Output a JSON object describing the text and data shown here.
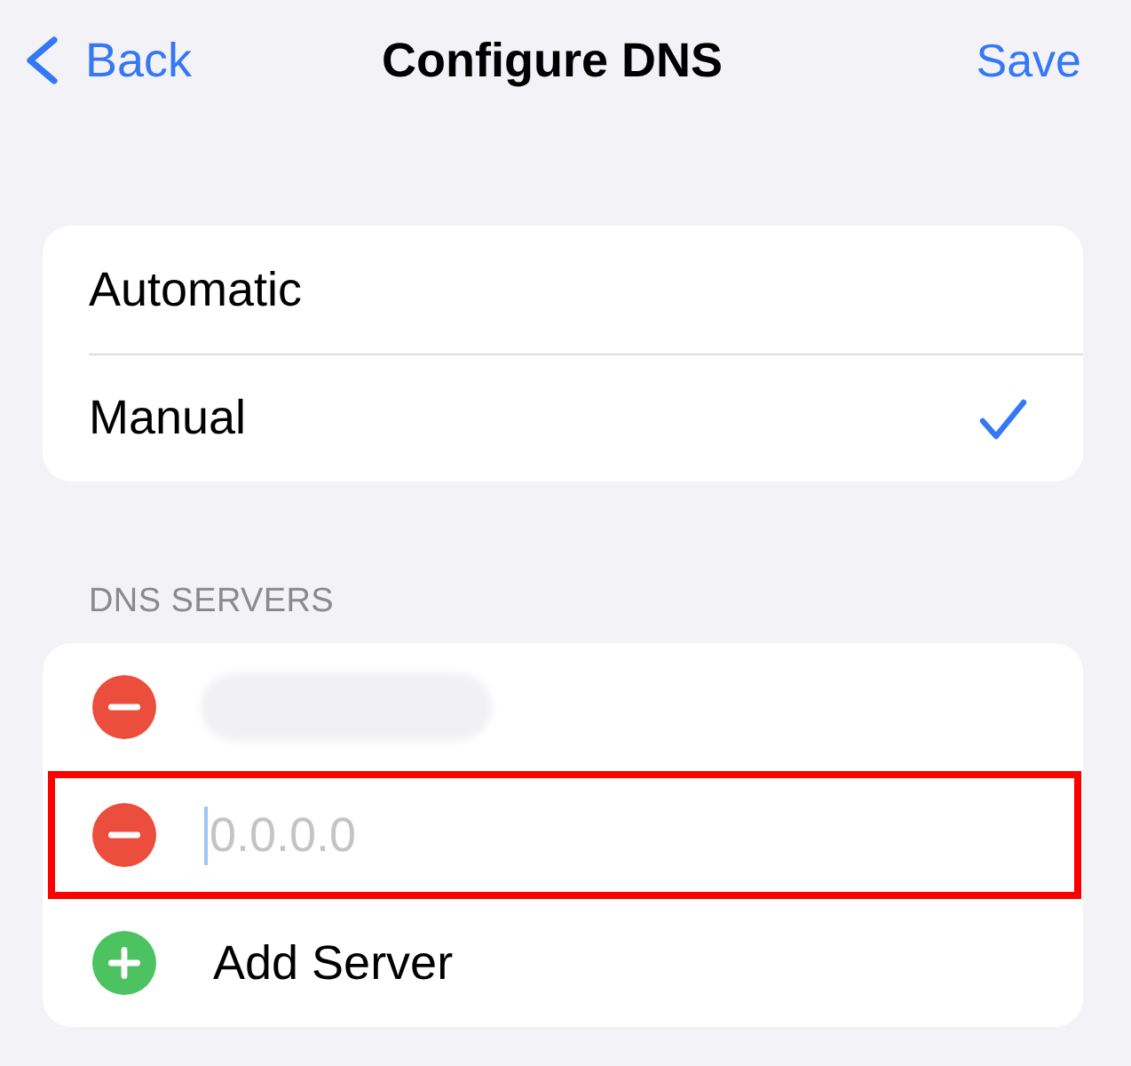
{
  "nav": {
    "back": "Back",
    "title": "Configure DNS",
    "save": "Save"
  },
  "modes": [
    {
      "label": "Automatic",
      "selected": false
    },
    {
      "label": "Manual",
      "selected": true
    }
  ],
  "servers_section": {
    "header": "DNS SERVERS",
    "servers": [
      {
        "kind": "redacted",
        "highlighted": false
      },
      {
        "kind": "field",
        "placeholder": "0.0.0.0",
        "focused": true,
        "highlighted": true
      }
    ],
    "add_label": "Add Server"
  }
}
